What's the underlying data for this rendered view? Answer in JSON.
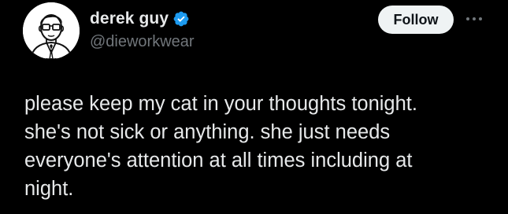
{
  "author": {
    "display_name": "derek guy",
    "handle": "@dieworkwear",
    "verified": true,
    "verified_color": "#1d9bf0",
    "avatar_icon": "cartoon-man-with-glasses-portrait"
  },
  "actions": {
    "follow_label": "Follow",
    "more_icon": "more-horizontal-icon"
  },
  "tweet": {
    "lines": [
      "please keep my cat in your thoughts tonight.",
      "she's not sick or anything. she just needs",
      "everyone's attention at all times including at",
      "night."
    ]
  },
  "colors": {
    "background": "#000000",
    "text_primary": "#e7e9ea",
    "text_secondary": "#71767b",
    "follow_button_bg": "#eff3f4",
    "follow_button_text": "#0f1419"
  }
}
